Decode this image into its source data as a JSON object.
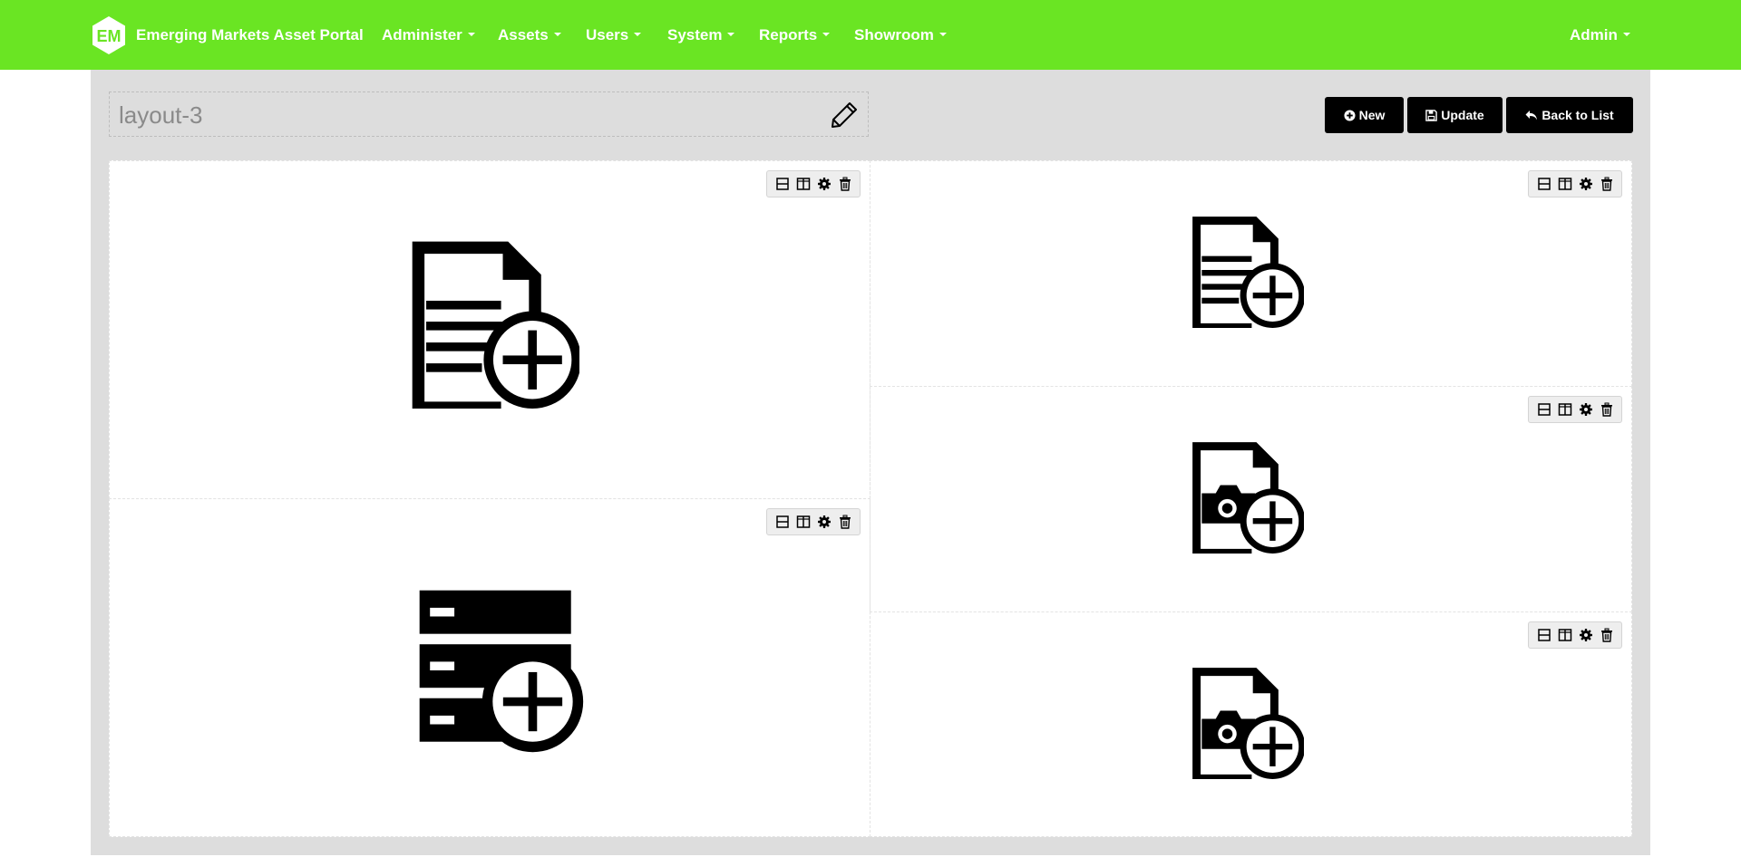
{
  "app": {
    "name": "Emerging Markets Asset Portal",
    "logo_text": "EM"
  },
  "nav": {
    "items": [
      {
        "label": "Administer"
      },
      {
        "label": "Assets"
      },
      {
        "label": "Users"
      },
      {
        "label": "System"
      },
      {
        "label": "Reports"
      },
      {
        "label": "Showroom"
      }
    ],
    "user_label": "Admin"
  },
  "layout": {
    "title": "layout-3"
  },
  "actions": {
    "new_label": "New",
    "update_label": "Update",
    "back_label": "Back to List"
  },
  "cells": [
    {
      "content": "document-add-icon",
      "tools": [
        "split-horizontal-icon",
        "split-vertical-icon",
        "gear-icon",
        "trash-icon"
      ]
    },
    {
      "content": "database-add-icon",
      "tools": [
        "split-horizontal-icon",
        "split-vertical-icon",
        "gear-icon",
        "trash-icon"
      ]
    },
    {
      "content": "document-add-icon",
      "tools": [
        "split-horizontal-icon",
        "split-vertical-icon",
        "gear-icon",
        "trash-icon"
      ]
    },
    {
      "content": "image-add-icon",
      "tools": [
        "split-horizontal-icon",
        "split-vertical-icon",
        "gear-icon",
        "trash-icon"
      ]
    },
    {
      "content": "image-add-icon",
      "tools": [
        "split-horizontal-icon",
        "split-vertical-icon",
        "gear-icon",
        "trash-icon"
      ]
    }
  ],
  "colors": {
    "navbar": "#6ae523",
    "page_bg": "#dddddd",
    "button_bg": "#000000"
  }
}
